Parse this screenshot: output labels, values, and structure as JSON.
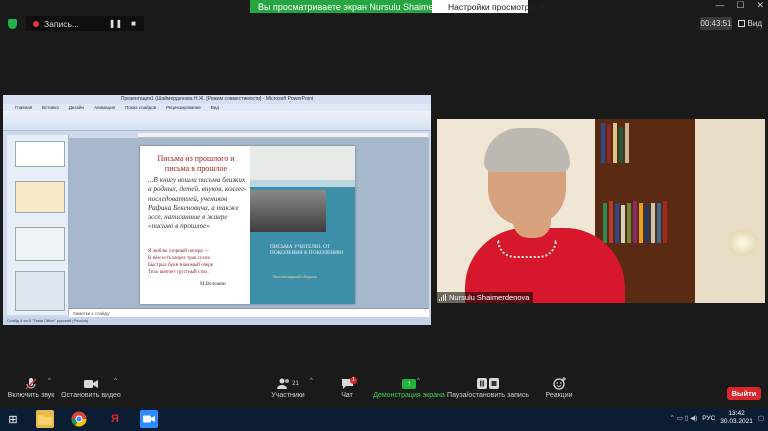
{
  "banner": {
    "share_text": "Вы просматриваете экран Nursulu Shaimerdenova",
    "view_options": "Настройки просмотра"
  },
  "recording": {
    "label": "Запись..."
  },
  "meeting": {
    "timer": "00:43:51",
    "view_label": "Вид"
  },
  "ppt": {
    "title": "Презентация1 (Шаймерденова Н.Ж. [Режим совместимости] - Microsoft PowerPoint",
    "tabs": [
      "Главная",
      "Вставка",
      "Дизайн",
      "Анимация",
      "Показ слайдов",
      "Рецензирование",
      "Вид"
    ],
    "notes": "Заметки к слайду",
    "status": "Слайд 4 из 9   \"Тема Office\"   русский (Россия)"
  },
  "slide": {
    "title": "Письма из прошлого и письма в прошлое",
    "body": "...В книгу вошли письма близких и родных, детей, внуков, коллег-последователей, учеников Рафика Бекеновича, а также эссе, написанные в жанре «письмо в прошлое»",
    "poem": [
      "Я люблю узорный почерк —",
      "В нём есть шорох трав сухих.",
      "Быстрых букв знакомый очерк",
      "Тихо шепчет грустный стих."
    ],
    "author": "М.Волошин",
    "book_title": "ПИСЬМА УЧИТЕЛЮ. ОТ ПОКОЛЕНИЯ К ПОКОЛЕНИЮ",
    "book_subtitle": "Эпистолярный сборник"
  },
  "video": {
    "participant_name": "Nursulu Shaimerdenova"
  },
  "toolbar": {
    "mute": "Включить звук",
    "video": "Остановить видео",
    "participants": "Участники",
    "participants_count": "21",
    "chat": "Чат",
    "chat_badge": "1",
    "share": "Демонстрация экрана",
    "record": "Пауза/остановить запись",
    "reactions": "Реакции",
    "leave": "Выйти"
  },
  "taskbar": {
    "lang": "РУС",
    "time": "13:42",
    "date": "30.03.2021"
  },
  "colors": {
    "share_green": "#26a641",
    "leave_red": "#d8262d",
    "taskbar": "#0b1d33"
  }
}
